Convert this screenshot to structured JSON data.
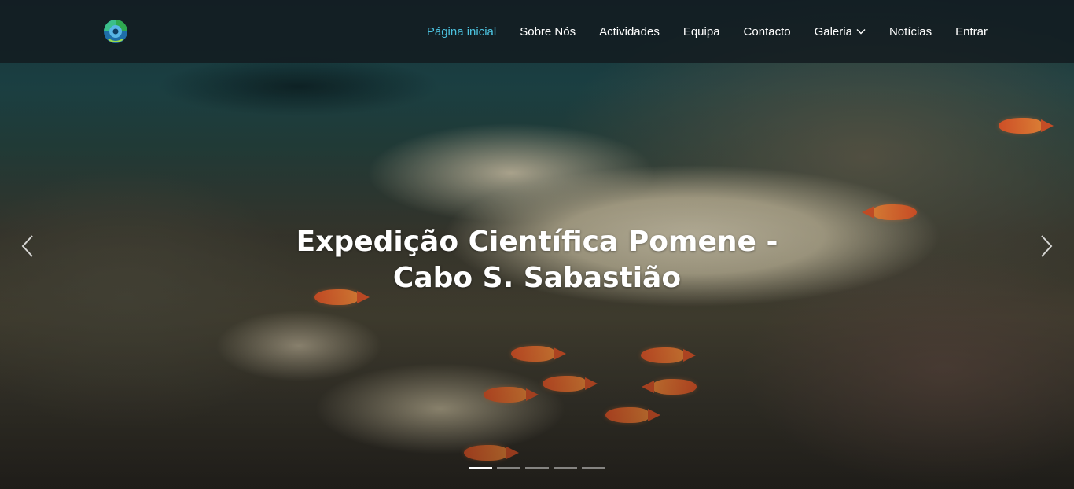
{
  "nav": {
    "logo_icon": "logo-icon",
    "items": [
      {
        "label": "Página inicial",
        "active": true
      },
      {
        "label": "Sobre Nós"
      },
      {
        "label": "Actividades"
      },
      {
        "label": "Equipa"
      },
      {
        "label": "Contacto"
      },
      {
        "label": "Galeria",
        "dropdown": true
      },
      {
        "label": "Notícias"
      },
      {
        "label": "Entrar"
      }
    ],
    "active_color": "#4cc3e0"
  },
  "carousel": {
    "caption": "Expedição Científica Pomene - Cabo S. Sabastião",
    "prev_icon": "chevron-left-icon",
    "next_icon": "chevron-right-icon",
    "slide_count": 5,
    "active_slide": 1
  }
}
